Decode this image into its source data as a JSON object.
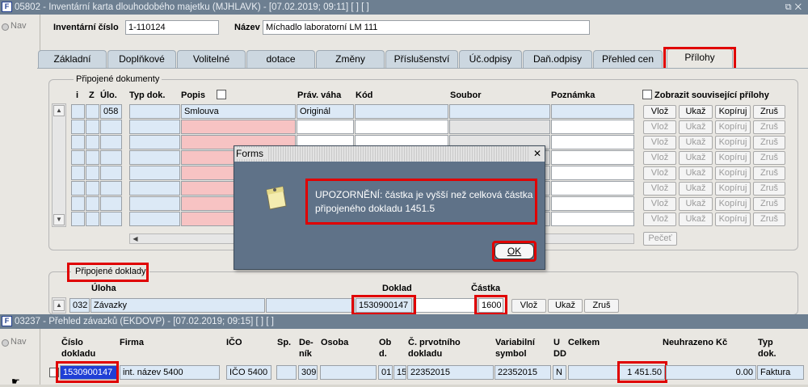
{
  "window1": {
    "title": "05802 - Inventární karta dlouhodobého majetku (MJHLAVK) - [07.02.2019; 09:11]  [ ]  [ ]",
    "side_radio_label": "Nav",
    "inv_label": "Inventární číslo",
    "inv_value": "1-110124",
    "name_label": "Název",
    "name_value": "Míchadlo laboratorní LM 111",
    "tabs": [
      "Základní",
      "Doplňkové",
      "Volitelné",
      "dotace",
      "Změny",
      "Příslušenství",
      "Úč.odpisy",
      "Daň.odpisy",
      "Přehled cen",
      "Přílohy"
    ],
    "docs": {
      "group_title": "Připojené dokumenty",
      "headers": {
        "i": "i",
        "z": "Z",
        "ulo": "Úlo.",
        "typ": "Typ dok.",
        "popis": "Popis",
        "prav": "Práv. váha",
        "kod": "Kód",
        "soubor": "Soubor",
        "poznamka": "Poznámka"
      },
      "row1": {
        "ulo": "058",
        "popis": "Smlouva",
        "prav": "Originál"
      },
      "show_related_label": "Zobrazit související přílohy",
      "buttons": {
        "vloz": "Vlož",
        "ukaz": "Ukaž",
        "kopiruj": "Kopíruj",
        "zrus": "Zruš"
      },
      "pecet": "Pečeť"
    },
    "links": {
      "group_title": "Připojené doklady",
      "h_uloha": "Úloha",
      "h_doklad": "Doklad",
      "h_castka": "Částka",
      "uloha_code": "032",
      "uloha_name": "Závazky",
      "doklad": "1530900147",
      "castka": "1600",
      "buttons": {
        "vloz": "Vlož",
        "ukaz": "Ukaž",
        "zrus": "Zruš"
      }
    }
  },
  "dialog": {
    "title": "Forms",
    "close": "✕",
    "message_line1": "UPOZORNĚNÍ: částka je vyšší než celková částka",
    "message_line2": "připojeného dokladu 1451.5",
    "ok_label": "OK"
  },
  "window2": {
    "title": "03237 - Přehled závazků (EKDOVP) - [07.02.2019; 09:15]  [ ]  [ ]",
    "side_radio_label": "Nav",
    "headers": {
      "cislo": [
        "Číslo",
        "dokladu"
      ],
      "firma": "Firma",
      "ico": "IČO",
      "sp": "Sp.",
      "denik": [
        "De-",
        "ník"
      ],
      "osoba": "Osoba",
      "obd": [
        "Ob",
        "d."
      ],
      "prvotni": [
        "Č. prvotního",
        "dokladu"
      ],
      "varsym": [
        "Variabilní",
        "symbol"
      ],
      "udd": [
        "U",
        "DD"
      ],
      "celkem": "Celkem",
      "neuhrazeno": "Neuhrazeno Kč",
      "typ": [
        "Typ",
        "dok."
      ]
    },
    "row": {
      "cislo": "1530900147",
      "firma": "int. název 5400",
      "ico": "IČO 5400",
      "denik": "309",
      "obd1": "01",
      "obd2": "15",
      "prvotni": "22352015",
      "varsym": "22352015",
      "udd": "N",
      "celkem": "1 451.50",
      "neuhrazeno": "0.00",
      "typ": "Faktura"
    }
  },
  "colors": {
    "title_bar": "#6d7f91",
    "highlight": "#e00000",
    "dialog_bg": "#5f7288",
    "selected_field": "#1f3fd6"
  }
}
